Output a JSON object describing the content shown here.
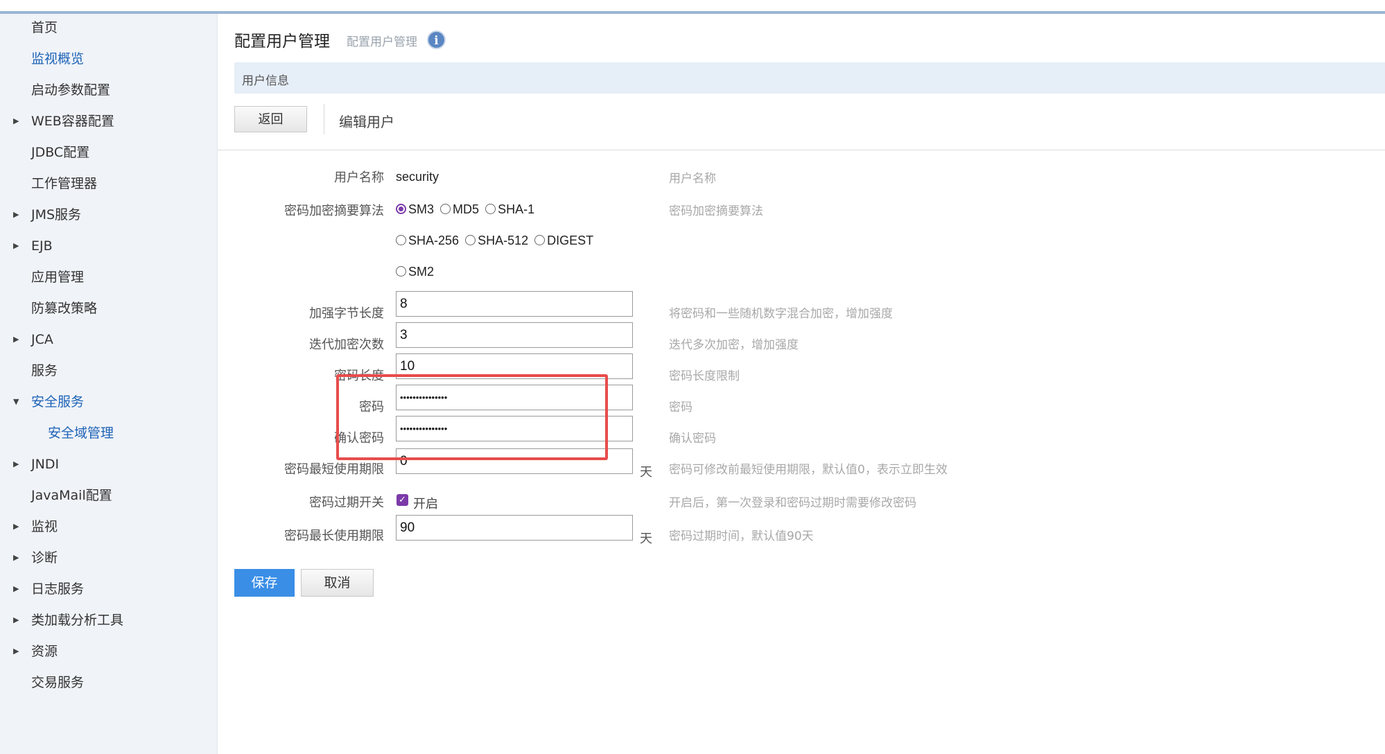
{
  "sidebar": {
    "items": [
      {
        "label": "首页",
        "expandable": false
      },
      {
        "label": "监视概览",
        "expandable": false,
        "active": true
      },
      {
        "label": "启动参数配置",
        "expandable": false
      },
      {
        "label": "WEB容器配置",
        "expandable": true
      },
      {
        "label": "JDBC配置",
        "expandable": false
      },
      {
        "label": "工作管理器",
        "expandable": false
      },
      {
        "label": "JMS服务",
        "expandable": true
      },
      {
        "label": "EJB",
        "expandable": true
      },
      {
        "label": "应用管理",
        "expandable": false
      },
      {
        "label": "防篡改策略",
        "expandable": false
      },
      {
        "label": "JCA",
        "expandable": true
      },
      {
        "label": "服务",
        "expandable": false
      },
      {
        "label": "安全服务",
        "expandable": true,
        "expanded": true,
        "active": true
      },
      {
        "label": "安全域管理",
        "sub": true
      },
      {
        "label": "JNDI",
        "expandable": true
      },
      {
        "label": "JavaMail配置",
        "expandable": false
      },
      {
        "label": "监视",
        "expandable": true
      },
      {
        "label": "诊断",
        "expandable": true
      },
      {
        "label": "日志服务",
        "expandable": true
      },
      {
        "label": "类加载分析工具",
        "expandable": true
      },
      {
        "label": "资源",
        "expandable": true
      },
      {
        "label": "交易服务",
        "expandable": false
      }
    ]
  },
  "header": {
    "title": "配置用户管理",
    "subtitle": "配置用户管理",
    "info_icon": "i",
    "section": "用户信息",
    "back_label": "返回",
    "edit_title": "编辑用户"
  },
  "form": {
    "username": {
      "label": "用户名称",
      "value": "security",
      "hint": "用户名称"
    },
    "algorithm": {
      "label": "密码加密摘要算法",
      "hint": "密码加密摘要算法",
      "options": [
        "SM3",
        "MD5",
        "SHA-1",
        "SHA-256",
        "SHA-512",
        "DIGEST",
        "SM2"
      ],
      "selected": "SM3"
    },
    "salt_length": {
      "label": "加强字节长度",
      "value": "8",
      "hint": "将密码和一些随机数字混合加密，增加强度"
    },
    "iterations": {
      "label": "迭代加密次数",
      "value": "3",
      "hint": "迭代多次加密，增加强度"
    },
    "password_length": {
      "label": "密码长度",
      "value": "10",
      "hint": "密码长度限制"
    },
    "password": {
      "label": "密码",
      "value": "•••••••••••••••",
      "hint": "密码"
    },
    "confirm_password": {
      "label": "确认密码",
      "value": "•••••••••••••••",
      "hint": "确认密码"
    },
    "min_age": {
      "label": "密码最短使用期限",
      "value": "0",
      "unit": "天",
      "hint": "密码可修改前最短使用期限，默认值0，表示立即生效"
    },
    "expire_switch": {
      "label": "密码过期开关",
      "checked": true,
      "text": "开启",
      "hint": "开启后，第一次登录和密码过期时需要修改密码"
    },
    "max_age": {
      "label": "密码最长使用期限",
      "value": "90",
      "unit": "天",
      "hint": "密码过期时间，默认值90天"
    }
  },
  "actions": {
    "save": "保存",
    "cancel": "取消"
  },
  "colors": {
    "accent": "#3a8ee6",
    "highlight": "#e84c4c",
    "radio_checked": "#7c3aa8"
  }
}
